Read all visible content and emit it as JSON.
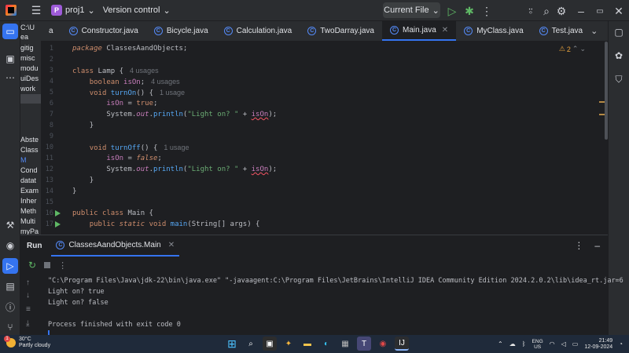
{
  "window": {
    "project_badge": "P",
    "project_name": "proj1",
    "version_control": "Version control",
    "run_config": "Current File"
  },
  "project_pane": {
    "items": [
      "C:\\U",
      "ea",
      "gitig",
      "misc",
      "modu",
      "uiDes",
      "work",
      "Abste",
      "Class",
      "M",
      "Cond",
      "datat",
      "Exam",
      "Inher",
      "Meth",
      "Multi",
      "myPa"
    ]
  },
  "tabs": [
    {
      "label": "a",
      "active": false
    },
    {
      "label": "Constructor.java",
      "active": false
    },
    {
      "label": "Bicycle.java",
      "active": false
    },
    {
      "label": "Calculation.java",
      "active": false
    },
    {
      "label": "TwoDarray.java",
      "active": false
    },
    {
      "label": "Main.java",
      "active": true
    },
    {
      "label": "MyClass.java",
      "active": false
    },
    {
      "label": "Test.java",
      "active": false
    }
  ],
  "editor": {
    "warnings_count": "2",
    "line_numbers": [
      "1",
      "2",
      "3",
      "4",
      "5",
      "6",
      "7",
      "8",
      "9",
      "10",
      "11",
      "12",
      "13",
      "14",
      "15",
      "16",
      "17"
    ],
    "hints": {
      "lamp_usages": "4 usages",
      "ison_usages": "4 usages",
      "turnon_usages": "1 usage",
      "turnoff_usages": "1 usage"
    },
    "code": {
      "package_kw": "package",
      "package_name": "ClassesAandObjects;",
      "class_kw": "class",
      "lamp": "Lamp",
      "brace_open": " {",
      "boolean_kw": "boolean",
      "ison": "isOn",
      "semi": ";",
      "void_kw": "void",
      "turnon": "turnOn",
      "turnoff": "turnOff",
      "parens_open": "() {",
      "assign": " = ",
      "true_kw": "true",
      "false_kw": "false",
      "system": "System.",
      "out": "out",
      "dot": ".",
      "println": "println",
      "lp": "(",
      "str": "\"Light on? \"",
      "plus": " + ",
      "rp": ");",
      "brace_close": "}",
      "public_kw": "public",
      "static_kw": "static",
      "main_cls": "Main",
      "main_fn": "main",
      "main_args": "(String[] args) {"
    }
  },
  "run_window": {
    "title": "Run",
    "tab_label": "ClassesAandObjects.Main",
    "console_lines": [
      "\"C:\\Program Files\\Java\\jdk-22\\bin\\java.exe\" \"-javaagent:C:\\Program Files\\JetBrains\\IntelliJ IDEA Community Edition 2024.2.0.2\\lib\\idea_rt.jar=6",
      "Light on? true",
      "Light on? false",
      "",
      "Process finished with exit code 0"
    ]
  },
  "taskbar": {
    "temperature": "30°C",
    "weather": "Partly cloudy",
    "lang_top": "ENG",
    "lang_bottom": "US",
    "time": "21:49",
    "date": "12-09-2024"
  }
}
